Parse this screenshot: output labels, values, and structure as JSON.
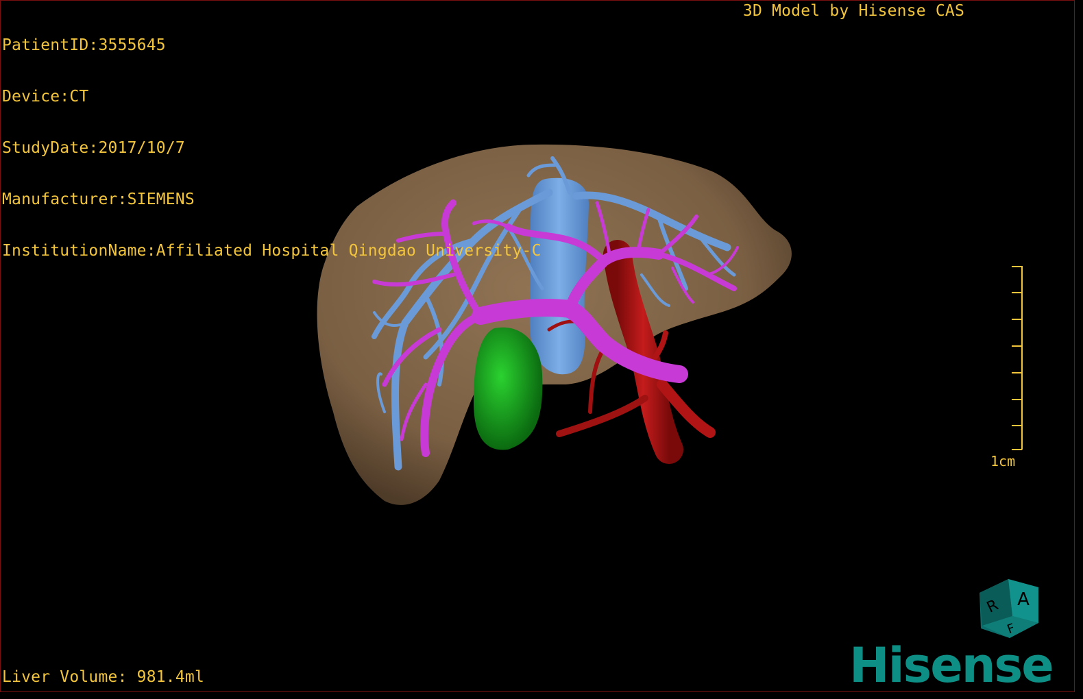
{
  "overlay": {
    "patient_id": "PatientID:3555645",
    "device": "Device:CT",
    "study_date": "StudyDate:2017/10/7",
    "manufacturer": "Manufacturer:SIEMENS",
    "institution": "InstitutionName:Affiliated Hospital Qingdao University-C",
    "caption": "3D Model by Hisense CAS",
    "liver_volume": "Liver Volume: 981.4ml"
  },
  "scale": {
    "label": "1cm"
  },
  "orientation_cube": {
    "face_top": "A",
    "face_left": "R",
    "face_bottom": "F"
  },
  "logo": {
    "text": "Hisense"
  },
  "colors": {
    "overlay_text": "#f2c53d",
    "liver": "#8a6e4f",
    "portal_vein": "#c83ad6",
    "hepatic_vein": "#6a9ad8",
    "artery": "#b01414",
    "gallbladder": "#16a01e",
    "logo": "#0e8f86"
  }
}
